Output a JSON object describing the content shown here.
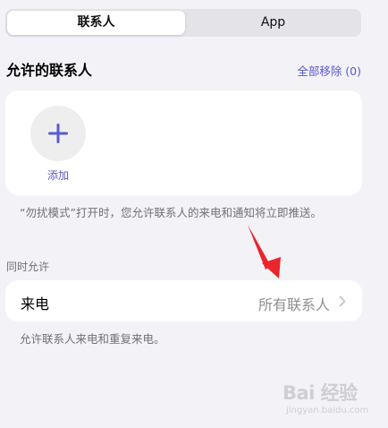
{
  "segmented": {
    "contacts": "联系人",
    "app": "App"
  },
  "allowed_contacts": {
    "title": "允许的联系人",
    "remove_all": "全部移除 (0)",
    "add_label": "添加",
    "note": "“勿扰模式”打开时，您允许联系人的来电和通知将立即推送。"
  },
  "also_allow": {
    "header": "同时允许",
    "calls_label": "来电",
    "calls_value": "所有联系人",
    "note": "允许联系人来电和重复来电。"
  },
  "colors": {
    "accent": "#5a59d1",
    "arrow": "#e8262b",
    "background": "#f2f2f7"
  },
  "icons": {
    "add": "plus-icon",
    "chevron": "chevron-right-icon",
    "annotation": "red-arrow-icon"
  },
  "watermark": {
    "main": "Bai 经验",
    "sub": "jingyan.baidu.com"
  }
}
